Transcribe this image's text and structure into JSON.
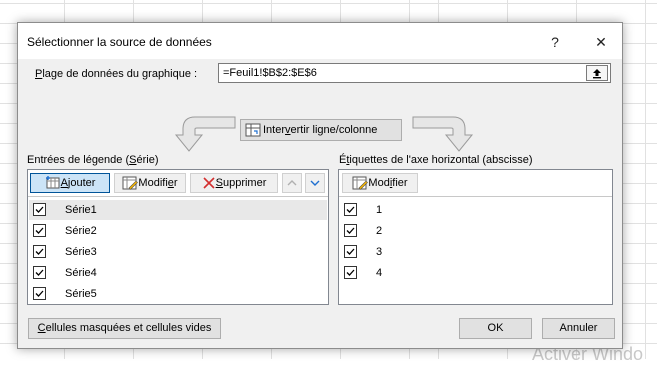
{
  "dialog": {
    "title": "Sélectionner la source de données",
    "help_label": "?",
    "close_label": "✕",
    "range_label_prefix": "P",
    "range_label_rest": "lage de données du graphique :",
    "range_value": "=Feuil1!$B$2:$E$6",
    "switch_prefix": "Inter",
    "switch_underline": "v",
    "switch_rest": "ertir ligne/colonne"
  },
  "legend_panel": {
    "title_prefix": "Entrées de légende (",
    "title_underline": "S",
    "title_rest": "érie)",
    "add_prefix": "",
    "add_underline": "A",
    "add_rest": "jouter",
    "edit_prefix": "Modifi",
    "edit_underline": "e",
    "edit_rest": "r",
    "delete_prefix": "",
    "delete_underline": "S",
    "delete_rest": "upprimer",
    "items": [
      {
        "label": "Série1",
        "checked": true,
        "selected": true
      },
      {
        "label": "Série2",
        "checked": true,
        "selected": false
      },
      {
        "label": "Série3",
        "checked": true,
        "selected": false
      },
      {
        "label": "Série4",
        "checked": true,
        "selected": false
      },
      {
        "label": "Série5",
        "checked": true,
        "selected": false
      }
    ]
  },
  "axis_panel": {
    "title_prefix": "É",
    "title_underline": "t",
    "title_rest": "iquettes de l'axe horizontal (abscisse)",
    "edit_prefix": "Mod",
    "edit_underline": "i",
    "edit_rest": "fier",
    "items": [
      {
        "label": "1",
        "checked": true
      },
      {
        "label": "2",
        "checked": true
      },
      {
        "label": "3",
        "checked": true
      },
      {
        "label": "4",
        "checked": true
      }
    ]
  },
  "footer": {
    "hidden_prefix": "",
    "hidden_underline": "C",
    "hidden_rest": "ellules masquées et cellules vides",
    "ok_label": "OK",
    "cancel_label": "Annuler"
  },
  "watermark": "Activer Windo"
}
